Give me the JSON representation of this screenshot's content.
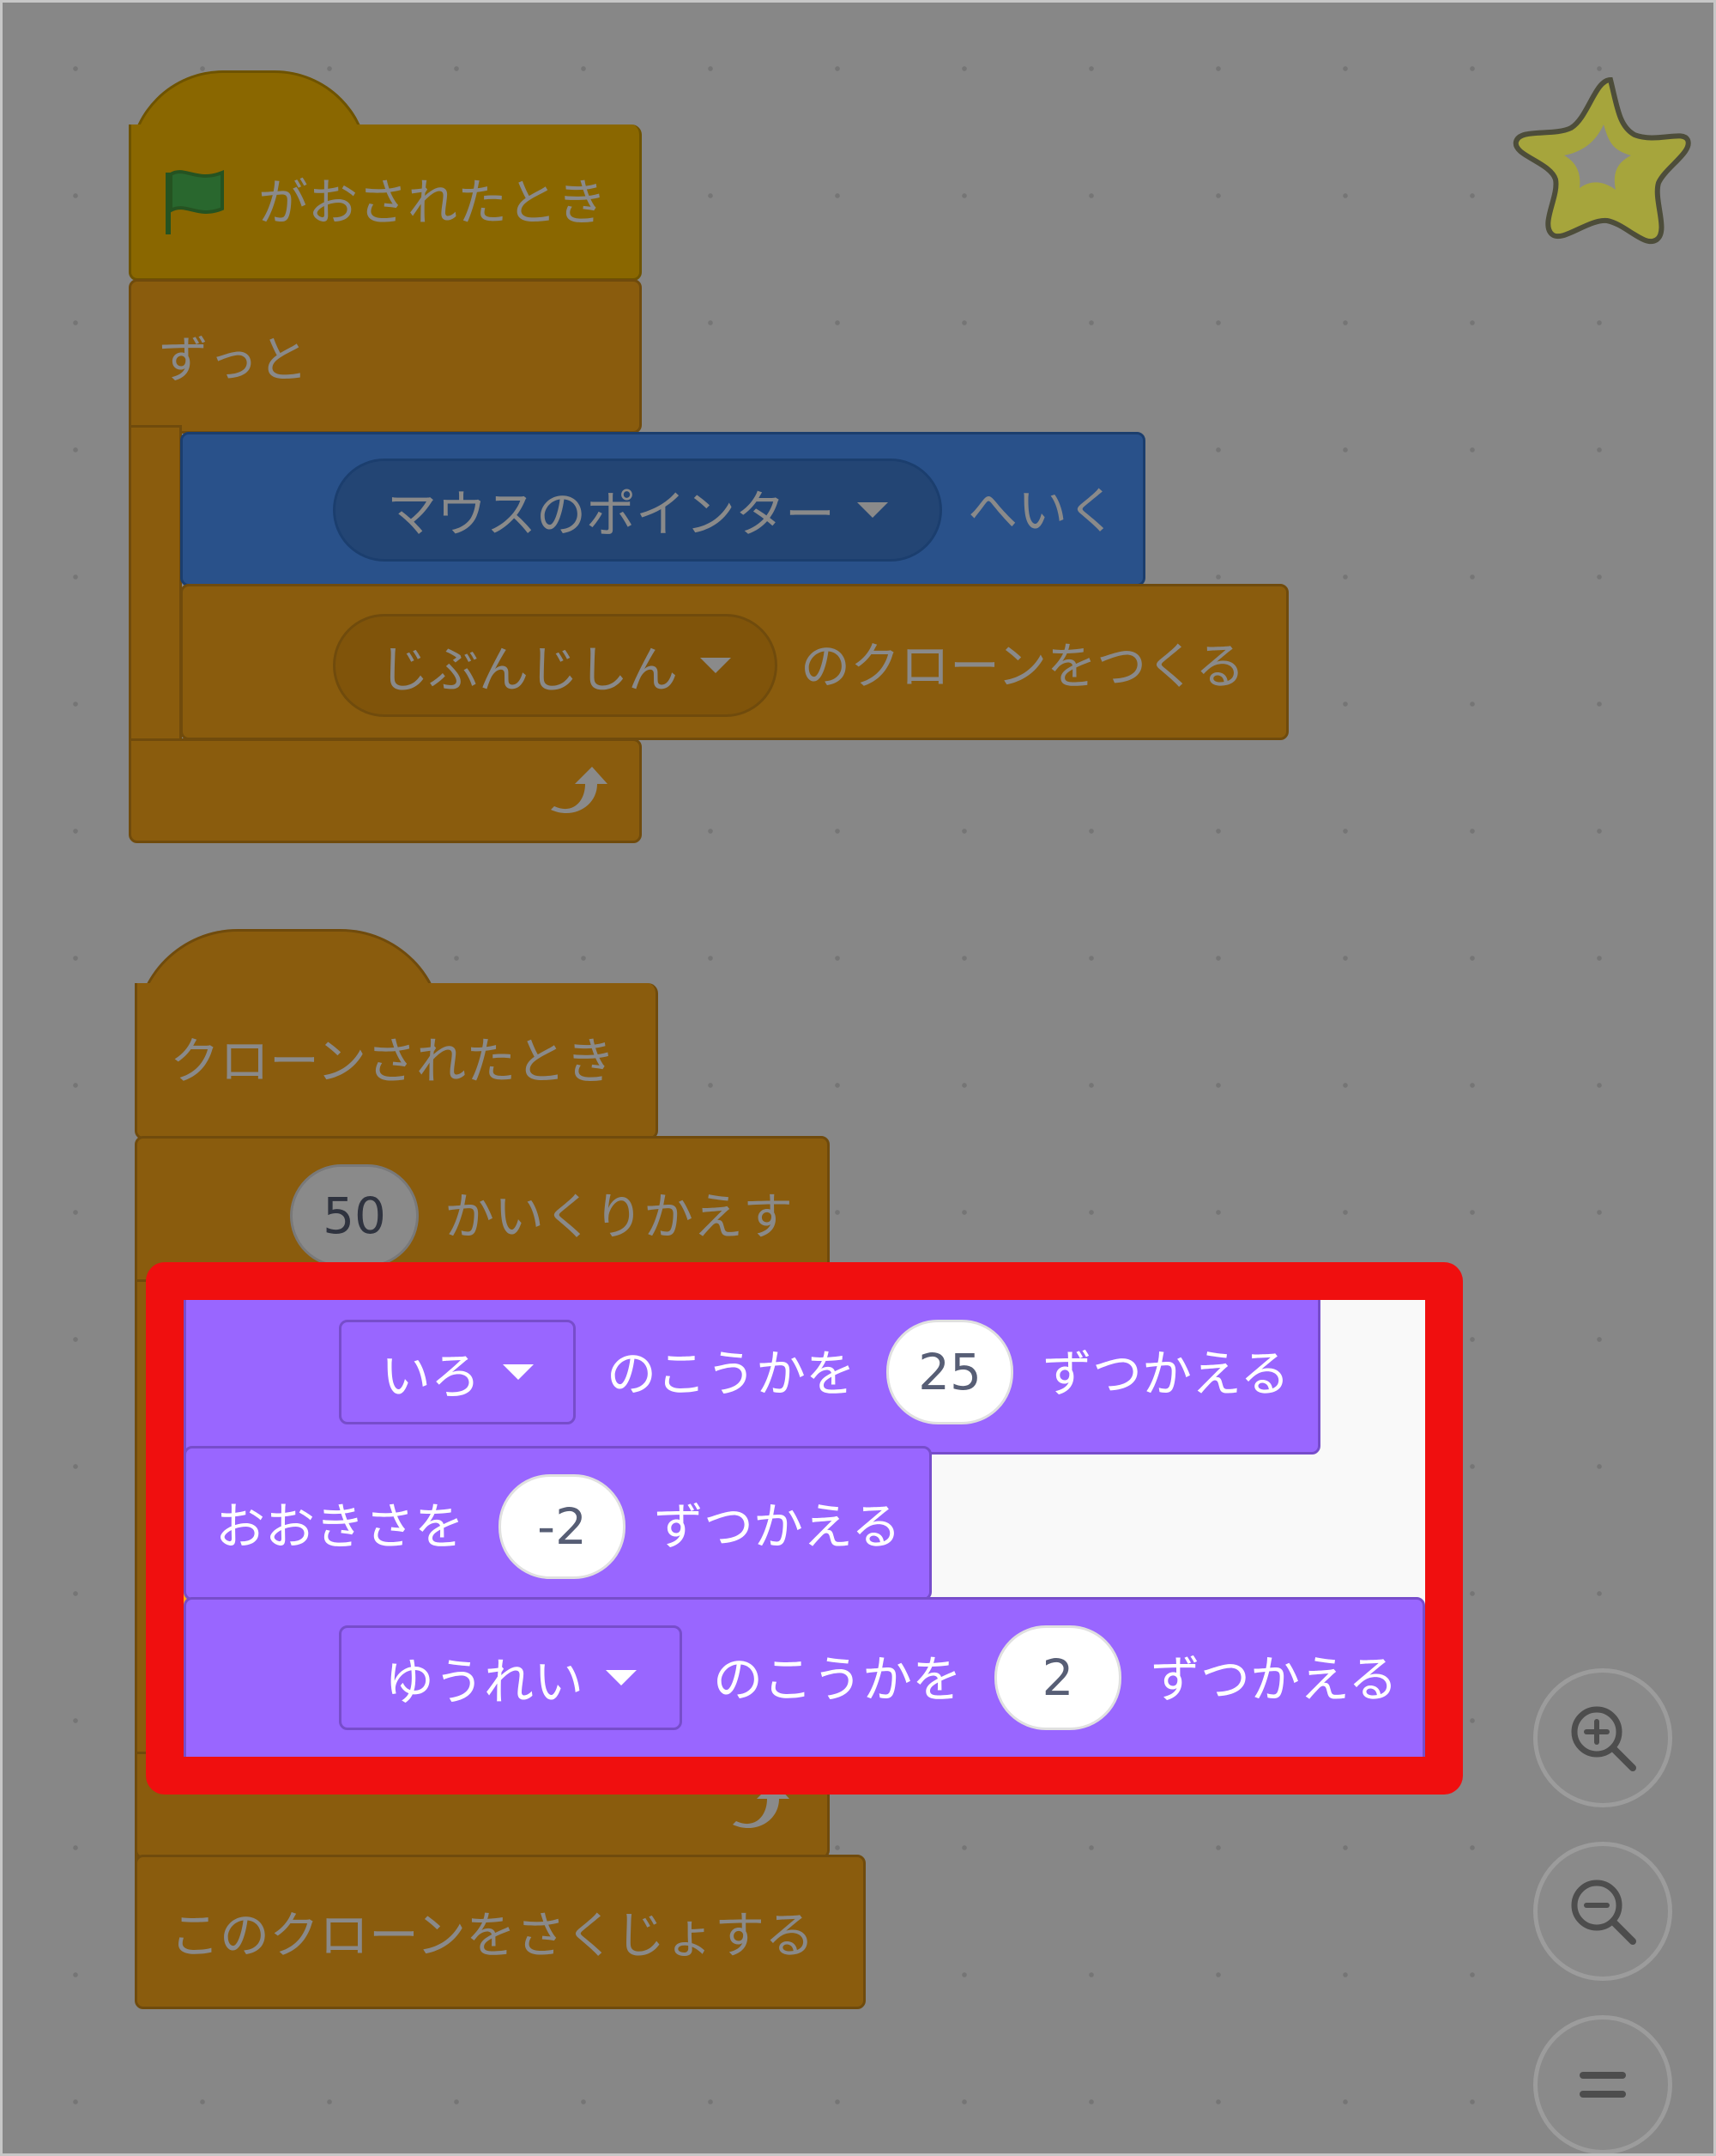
{
  "script1": {
    "hat_label": "がおされたとき",
    "forever_label": "ずっと",
    "goto_target": "マウスのポインター",
    "goto_suffix": "へいく",
    "clone_target": "じぶんじしん",
    "clone_suffix": "のクローンをつくる"
  },
  "script2": {
    "hat_label": "クローンされたとき",
    "repeat_count": "50",
    "repeat_label": "かいくりかえす",
    "effect1_name": "いろ",
    "effect1_mid": "のこうかを",
    "effect1_value": "25",
    "effect1_suffix": "ずつかえる",
    "size_prefix": "おおきさを",
    "size_value": "-2",
    "size_suffix": "ずつかえる",
    "effect2_name": "ゆうれい",
    "effect2_mid": "のこうかを",
    "effect2_value": "2",
    "effect2_suffix": "ずつかえる",
    "delete_label": "このクローンをさくじょする"
  },
  "colors": {
    "events": "#ffbf00",
    "control": "#ffab19",
    "motion": "#4c97ff",
    "looks": "#9966ff",
    "highlight": "#f00f0f"
  },
  "icons": {
    "flag": "green-flag-icon",
    "loop": "loop-arrow-icon",
    "zoom_in": "zoom-in-icon",
    "zoom_out": "zoom-out-icon",
    "reset": "zoom-reset-icon",
    "sprite": "star-sprite-icon"
  }
}
